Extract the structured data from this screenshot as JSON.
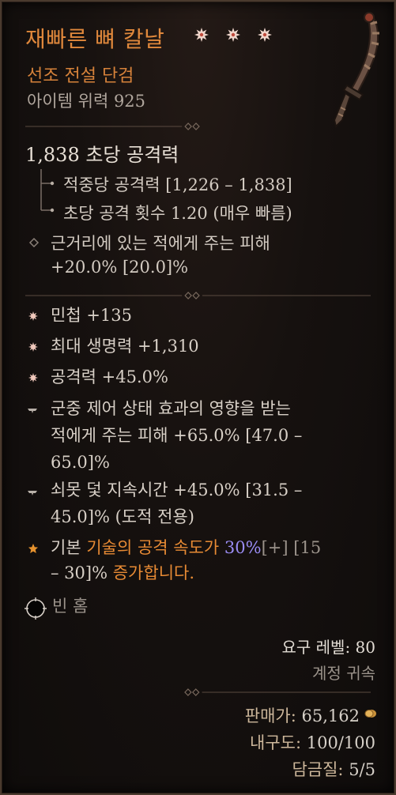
{
  "item": {
    "name": "재빠른 뼈 칼날",
    "stars": [
      "flower-star-icon",
      "flower-star-icon",
      "flower-star-icon"
    ],
    "type": "선조 전설 단검",
    "power": "아이템 위력 925",
    "weapon_icon": "bone-dagger-icon"
  },
  "stats": {
    "dps": "1,838 초당 공격력",
    "damage_per_hit": "적중당 공격력 [1,226 – 1,838]",
    "attacks_per_second": "초당 공격 횟수 1.20 (매우 빠름)",
    "implicit_line1": "근거리에 있는 적에게 주는 피해",
    "implicit_line2": "+20.0% [20.0]%"
  },
  "affixes": {
    "a1": "민첩 +135",
    "a2": "최대 생명력 +1,310",
    "a3": "공격력 +45.0%",
    "a4_line1": "군중 제어 상태 효과의 영향을 받는",
    "a4_line2": "적에게 주는 피해 +65.0% [47.0 –",
    "a4_line3": "65.0]%",
    "a5_line1": "쇠못 덫 지속시간 +45.0% [31.5 –",
    "a5_line2": "45.0]% (도적 전용)",
    "legendary_prefix": "기본 ",
    "legendary_skill": "기술의 공격 속도가 ",
    "legendary_value": "30%",
    "legendary_range": "[+] [15",
    "legendary_line2_a": "– 30]% ",
    "legendary_line2_b": "증가합니다."
  },
  "socket": {
    "label": "빈 홈"
  },
  "footer": {
    "required_level": "요구 레벨: 80",
    "account_bound": "계정 귀속",
    "sell_label": "판매가:",
    "sell_value": " 65,162",
    "durability_label": "내구도:",
    "durability_value": " 100/100",
    "temper_label": "담금질:",
    "temper_value": " 5/5"
  },
  "colors": {
    "legendary_orange": "#e0883c",
    "text": "#d8d0c7",
    "value_blue": "#9a8cf4",
    "muted": "#9a928a"
  }
}
